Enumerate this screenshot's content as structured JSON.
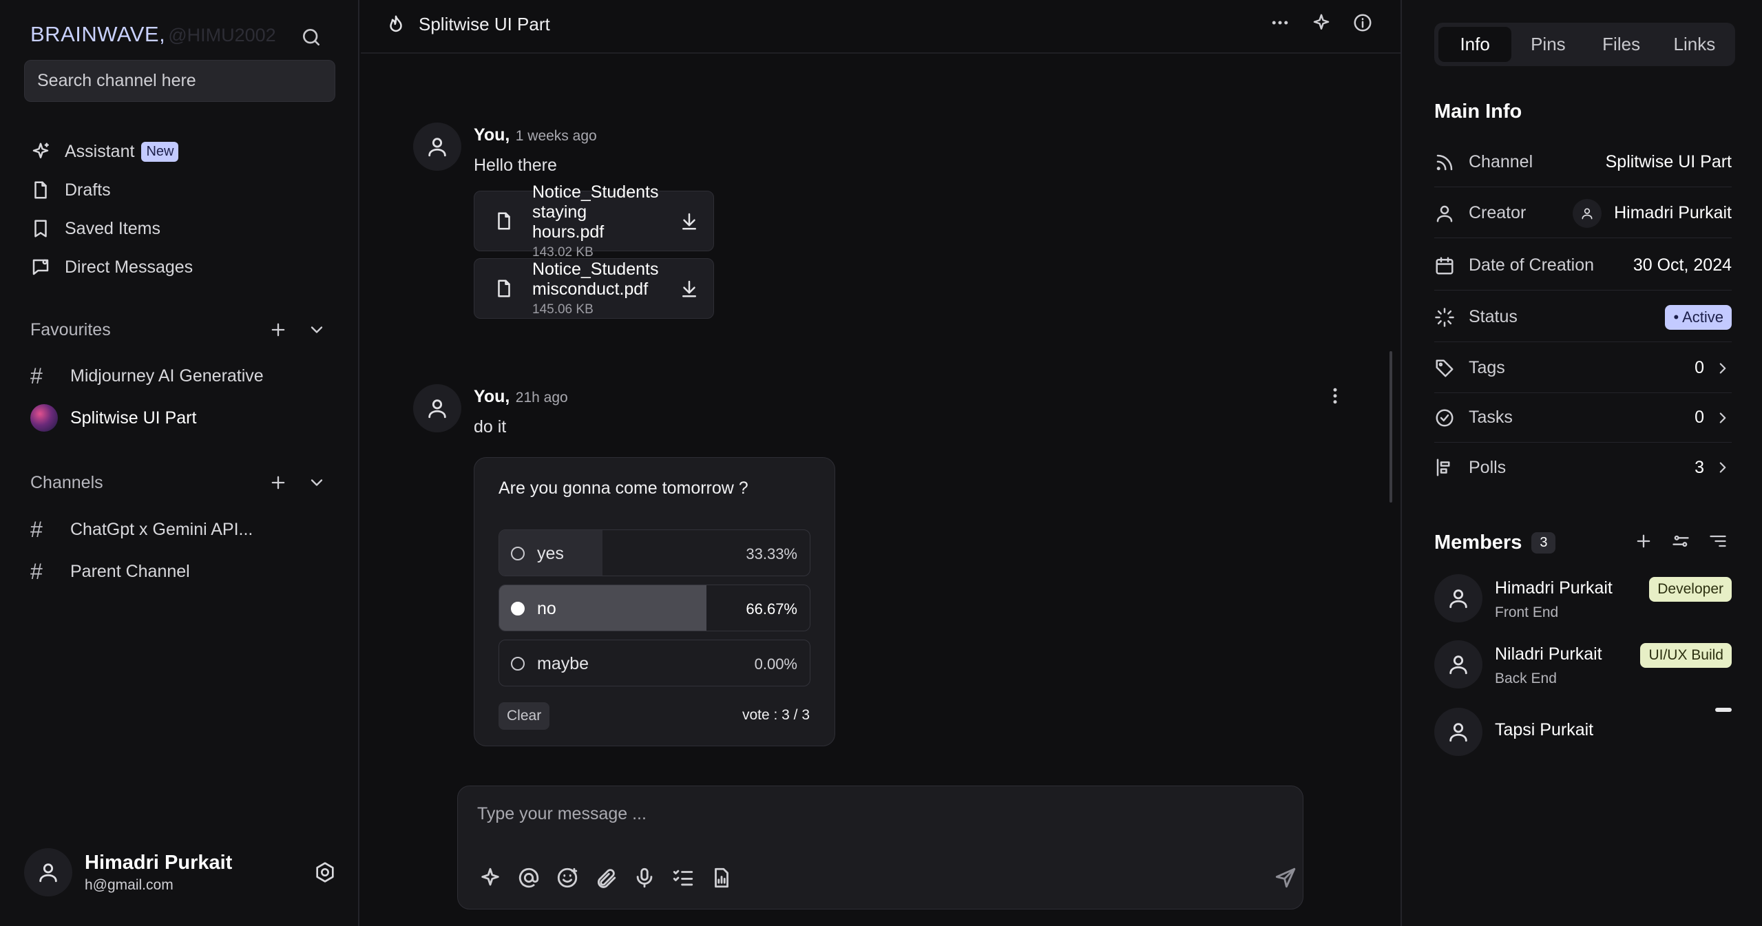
{
  "sidebar": {
    "brand": "BRAINWAVE,",
    "handle": "@HIMU2002",
    "search_placeholder": "Search channel here",
    "nav": [
      {
        "label": "Assistant",
        "badge": "New",
        "icon": "sparkle-icon"
      },
      {
        "label": "Drafts",
        "icon": "file-icon"
      },
      {
        "label": "Saved Items",
        "icon": "bookmark-icon"
      },
      {
        "label": "Direct Messages",
        "icon": "message-icon"
      }
    ],
    "favourites": {
      "label": "Favourites",
      "items": [
        {
          "label": "Midjourney AI Generative",
          "icon": "hash-icon"
        },
        {
          "label": "Splitwise UI Part",
          "icon": "channel-avatar",
          "active": true
        }
      ]
    },
    "channels": {
      "label": "Channels",
      "items": [
        {
          "label": "ChatGpt x Gemini API...",
          "icon": "hash-icon"
        },
        {
          "label": "Parent Channel",
          "icon": "hash-icon"
        }
      ]
    },
    "user": {
      "name": "Himadri Purkait",
      "email": "h@gmail.com"
    }
  },
  "main": {
    "channel_title": "Splitwise UI Part",
    "messages": [
      {
        "author": "You,",
        "time": "1 weeks ago",
        "text": "Hello there",
        "files": [
          {
            "name": "Notice_Students staying hours.pdf",
            "size": "143.02 KB"
          },
          {
            "name": "Notice_Students misconduct.pdf",
            "size": "145.06 KB"
          }
        ]
      },
      {
        "author": "You,",
        "time": "21h ago",
        "text": "do it",
        "poll": {
          "question": "Are you gonna come tomorrow ?",
          "options": [
            {
              "label": "yes",
              "percent": "33.33%",
              "fraction": 0.3333,
              "selected": false
            },
            {
              "label": "no",
              "percent": "66.67%",
              "fraction": 0.6667,
              "selected": true
            },
            {
              "label": "maybe",
              "percent": "0.00%",
              "fraction": 0.0,
              "selected": false
            }
          ],
          "clear_label": "Clear",
          "votes": "vote : 3 / 3"
        }
      }
    ],
    "composer_placeholder": "Type your message ..."
  },
  "right": {
    "tabs": [
      "Info",
      "Pins",
      "Files",
      "Links"
    ],
    "active_tab": "Info",
    "main_info_title": "Main Info",
    "info": {
      "channel": {
        "label": "Channel",
        "value": "Splitwise UI Part"
      },
      "creator": {
        "label": "Creator",
        "value": "Himadri Purkait"
      },
      "date": {
        "label": "Date of Creation",
        "value": "30 Oct, 2024"
      },
      "status": {
        "label": "Status",
        "value": "• Active"
      },
      "tags": {
        "label": "Tags",
        "value": "0"
      },
      "tasks": {
        "label": "Tasks",
        "value": "0"
      },
      "polls": {
        "label": "Polls",
        "value": "3"
      }
    },
    "members_title": "Members",
    "members_count": "3",
    "members": [
      {
        "name": "Himadri Purkait",
        "role": "Front End",
        "tag": "Developer"
      },
      {
        "name": "Niladri Purkait",
        "role": "Back End",
        "tag": "UI/UX Build"
      },
      {
        "name": "Tapsi Purkait",
        "role": "",
        "tag": ""
      }
    ]
  },
  "colors": {
    "background": "#0f0f11",
    "panel": "#111113",
    "accent_badge": "#c3caff",
    "member_tag": "#e7efc6"
  }
}
